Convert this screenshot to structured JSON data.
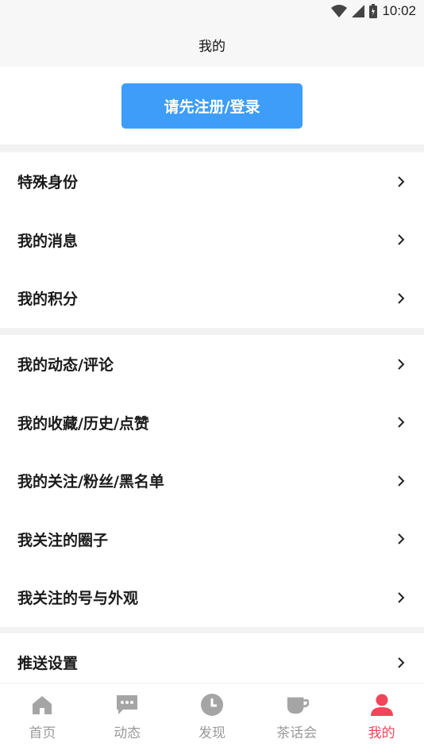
{
  "status_bar": {
    "time": "10:02"
  },
  "header": {
    "title": "我的"
  },
  "login": {
    "button_label": "请先注册/登录"
  },
  "groups": [
    {
      "items": [
        "特殊身份",
        "我的消息",
        "我的积分"
      ]
    },
    {
      "items": [
        "我的动态/评论",
        "我的收藏/历史/点赞",
        "我的关注/粉丝/黑名单",
        "我关注的圈子",
        "我关注的号与外观"
      ]
    },
    {
      "items": [
        "推送设置"
      ]
    }
  ],
  "tabs": [
    {
      "label": "首页",
      "icon": "home-icon"
    },
    {
      "label": "动态",
      "icon": "chat-icon"
    },
    {
      "label": "发现",
      "icon": "clock-icon"
    },
    {
      "label": "茶话会",
      "icon": "tea-cup-icon"
    },
    {
      "label": "我的",
      "icon": "user-icon",
      "active": true
    }
  ],
  "colors": {
    "accent": "#3d9df8",
    "active_tab": "#f0455a",
    "inactive_tab": "#9a9a9a"
  }
}
